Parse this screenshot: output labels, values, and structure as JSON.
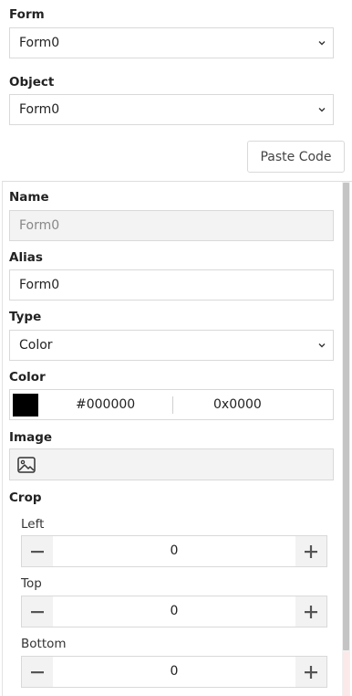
{
  "form": {
    "label": "Form",
    "selected": "Form0"
  },
  "object": {
    "label": "Object",
    "selected": "Form0"
  },
  "paste_code": {
    "label": "Paste Code"
  },
  "properties": {
    "name": {
      "label": "Name",
      "value": "Form0"
    },
    "alias": {
      "label": "Alias",
      "value": "Form0"
    },
    "type": {
      "label": "Type",
      "selected": "Color"
    },
    "color": {
      "label": "Color",
      "swatch": "#000000",
      "hex": "#000000",
      "hex16": "0x0000"
    },
    "image": {
      "label": "Image",
      "icon": "image-icon"
    },
    "crop": {
      "label": "Crop",
      "left": {
        "label": "Left",
        "value": "0"
      },
      "top": {
        "label": "Top",
        "value": "0"
      },
      "bottom": {
        "label": "Bottom",
        "value": "0"
      }
    }
  }
}
